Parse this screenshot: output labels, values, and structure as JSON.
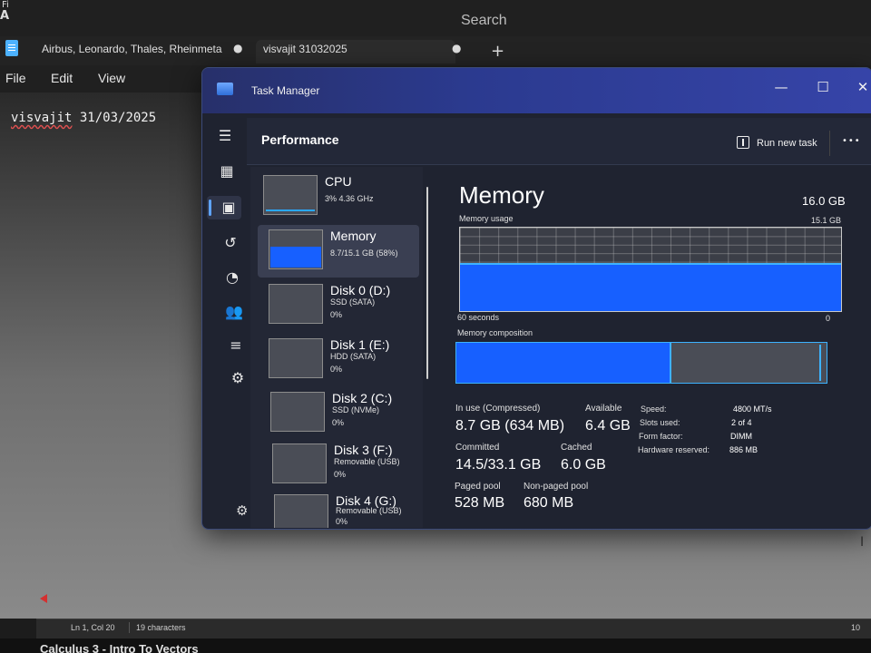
{
  "os": {
    "corner_glyph_top": "Fi",
    "corner_glyph_bottom": "A",
    "search_placeholder": "Search"
  },
  "notepad": {
    "tabs": [
      {
        "label": "Airbus, Leonardo, Thales, Rheinmeta"
      },
      {
        "label": "visvajit 31032025"
      }
    ],
    "unsaved_dot": "●",
    "new_tab_label": "+",
    "menu": {
      "file": "File",
      "edit": "Edit",
      "view": "View"
    },
    "content": {
      "misspelled_word": "visvajit",
      "rest": " 31/03/2025"
    },
    "status": {
      "position": "Ln 1, Col 20",
      "chars": "19 characters",
      "zoom_partial": "10"
    },
    "below_window_text": "Calculus 3 - Intro To Vectors"
  },
  "task_manager": {
    "title": "Task Manager",
    "controls": {
      "minimize": "—",
      "maximize": "☐",
      "close": "✕"
    },
    "page_title": "Performance",
    "run_new_task": "Run new task",
    "more": "•••",
    "resources": [
      {
        "name": "CPU",
        "detail": "3% 4.36 GHz"
      },
      {
        "name": "Memory",
        "detail": "8.7/15.1 GB (58%)"
      },
      {
        "name": "Disk 0 (D:)",
        "type": "SSD (SATA)",
        "usage": "0%"
      },
      {
        "name": "Disk 1 (E:)",
        "type": "HDD (SATA)",
        "usage": "0%"
      },
      {
        "name": "Disk 2 (C:)",
        "type": "SSD (NVMe)",
        "usage": "0%"
      },
      {
        "name": "Disk 3 (F:)",
        "type": "Removable (USB)",
        "usage": "0%"
      },
      {
        "name": "Disk 4 (G:)",
        "type": "Removable (USB)",
        "usage": "0%"
      }
    ],
    "memory": {
      "title": "Memory",
      "total": "16.0 GB",
      "usage_label": "Memory usage",
      "usage_max": "15.1 GB",
      "usage_fraction": 0.58,
      "time_left": "60 seconds",
      "time_right": "0",
      "composition_label": "Memory composition",
      "composition_in_use_fraction": 0.58,
      "stats": {
        "in_use_label": "In use (Compressed)",
        "in_use_value": "8.7 GB (634 MB)",
        "available_label": "Available",
        "available_value": "6.4 GB",
        "committed_label": "Committed",
        "committed_value": "14.5/33.1 GB",
        "cached_label": "Cached",
        "cached_value": "6.0 GB",
        "paged_label": "Paged pool",
        "paged_value": "528 MB",
        "nonpaged_label": "Non-paged pool",
        "nonpaged_value": "680 MB"
      },
      "specs": [
        {
          "label": "Speed:",
          "value": "4800 MT/s"
        },
        {
          "label": "Slots used:",
          "value": "2 of 4"
        },
        {
          "label": "Form factor:",
          "value": "DIMM"
        },
        {
          "label": "Hardware reserved:",
          "value": "886 MB"
        }
      ]
    }
  },
  "colors": {
    "accent_blue": "#1760ff",
    "accent_cyan": "#3db2ff",
    "title_gradient_end": "#3644a8"
  }
}
